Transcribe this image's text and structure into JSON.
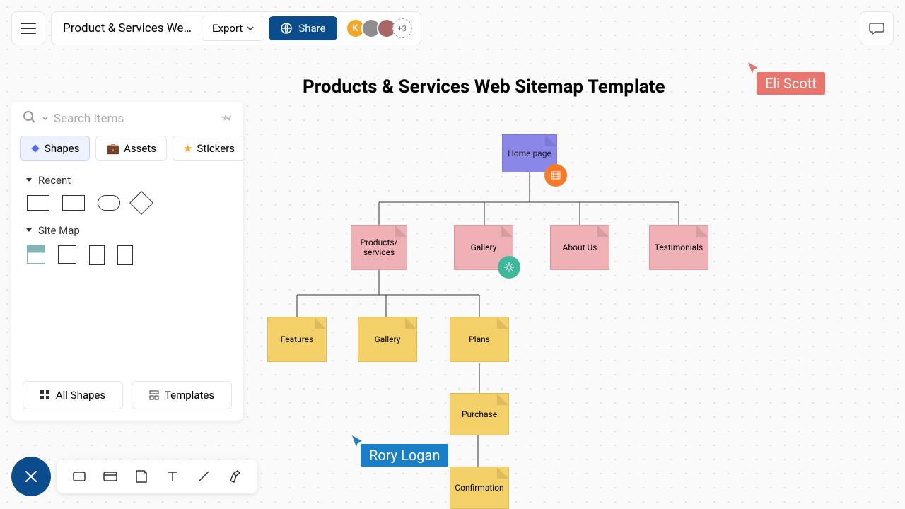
{
  "header": {
    "title": "Product & Services Web…",
    "export": "Export",
    "share": "Share",
    "avatar_letter": "K",
    "avatar_more": "+3"
  },
  "search": {
    "placeholder": "Search Items"
  },
  "tabs": {
    "shapes": "Shapes",
    "assets": "Assets",
    "stickers": "Stickers"
  },
  "sections": {
    "recent": "Recent",
    "sitemap": "Site Map"
  },
  "sidebar_buttons": {
    "all_shapes": "All Shapes",
    "templates": "Templates"
  },
  "canvas": {
    "title": "Products & Services Web Sitemap Template",
    "nodes": {
      "home": "Home page",
      "products": "Products/\nservices",
      "gallery": "Gallery",
      "about": "About Us",
      "testimonials": "Testimonials",
      "features": "Features",
      "gallery2": "Gallery",
      "plans": "Plans",
      "purchase": "Purchase",
      "confirmation": "Confirmation"
    }
  },
  "collaborators": {
    "eli": "Eli Scott",
    "rory": "Rory Logan"
  },
  "colors": {
    "purple": "#8b87e8",
    "pink": "#efb0b6",
    "yellow": "#f4d168",
    "orange": "#f47b2a",
    "teal": "#3eb89a",
    "eli": "#e8766f",
    "rory": "#1a7fc9"
  }
}
